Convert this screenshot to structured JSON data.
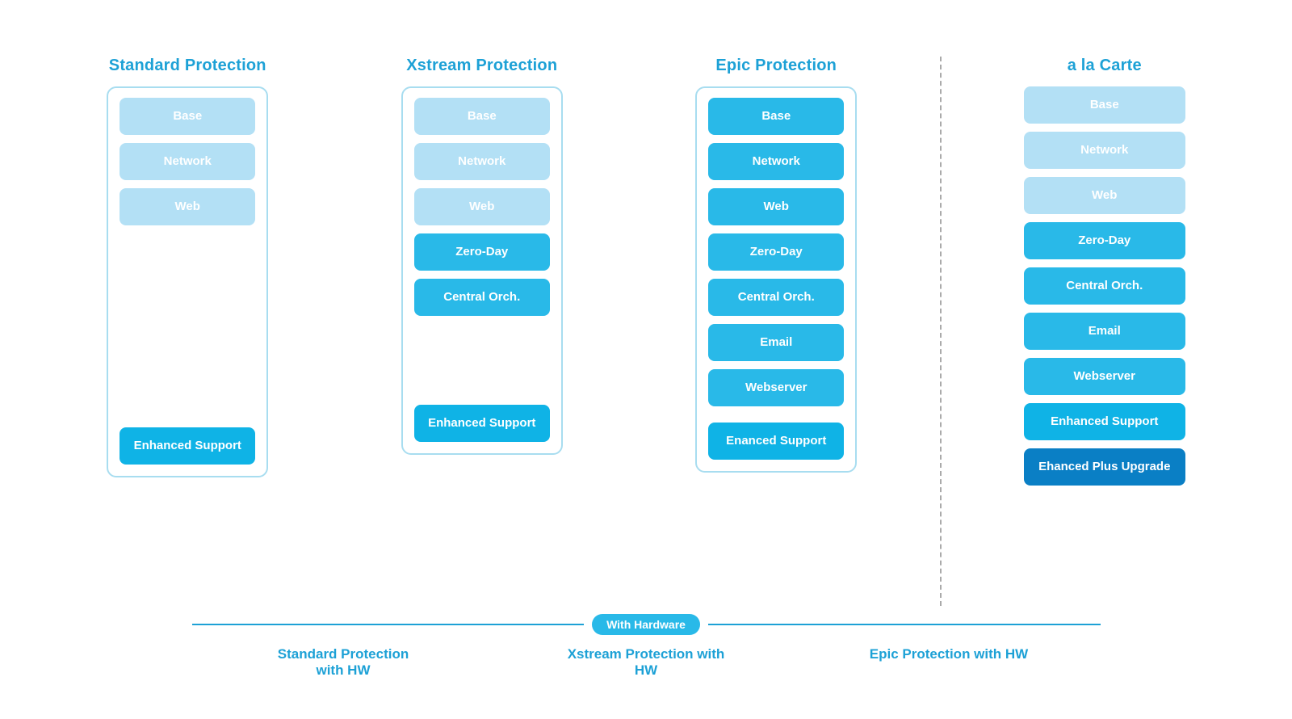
{
  "columns": [
    {
      "id": "standard",
      "title": "Standard Protection",
      "hasBox": true,
      "buttons_top": [
        {
          "label": "Base",
          "style": "light"
        },
        {
          "label": "Network",
          "style": "light"
        },
        {
          "label": "Web",
          "style": "light"
        }
      ],
      "button_support": {
        "label": "Enhanced\nSupport",
        "style": "dark"
      }
    },
    {
      "id": "xstream",
      "title": "Xstream Protection",
      "hasBox": true,
      "buttons_top": [
        {
          "label": "Base",
          "style": "light"
        },
        {
          "label": "Network",
          "style": "light"
        },
        {
          "label": "Web",
          "style": "light"
        },
        {
          "label": "Zero-Day",
          "style": "medium"
        },
        {
          "label": "Central Orch.",
          "style": "medium"
        }
      ],
      "button_support": {
        "label": "Enhanced\nSupport",
        "style": "dark"
      }
    },
    {
      "id": "epic",
      "title": "Epic Protection",
      "hasBox": true,
      "buttons_top": [
        {
          "label": "Base",
          "style": "medium"
        },
        {
          "label": "Network",
          "style": "medium"
        },
        {
          "label": "Web",
          "style": "medium"
        },
        {
          "label": "Zero-Day",
          "style": "medium"
        },
        {
          "label": "Central Orch.",
          "style": "medium"
        },
        {
          "label": "Email",
          "style": "medium"
        },
        {
          "label": "Webserver",
          "style": "medium"
        }
      ],
      "button_support": {
        "label": "Enanced\nSupport",
        "style": "dark"
      }
    }
  ],
  "alacarte": {
    "title": "a la Carte",
    "buttons": [
      {
        "label": "Base",
        "style": "light"
      },
      {
        "label": "Network",
        "style": "light"
      },
      {
        "label": "Web",
        "style": "light"
      },
      {
        "label": "Zero-Day",
        "style": "medium"
      },
      {
        "label": "Central Orch.",
        "style": "medium"
      },
      {
        "label": "Email",
        "style": "medium"
      },
      {
        "label": "Webserver",
        "style": "medium"
      },
      {
        "label": "Enhanced\nSupport",
        "style": "dark"
      },
      {
        "label": "Ehanced\nPlus Upgrade",
        "style": "darkest"
      }
    ]
  },
  "hardware": {
    "badge": "With Hardware",
    "labels": [
      {
        "text": "Standard Protection\nwith HW"
      },
      {
        "text": "Xstream Protection\nwith HW"
      },
      {
        "text": "Epic Protection\nwith HW"
      }
    ]
  }
}
